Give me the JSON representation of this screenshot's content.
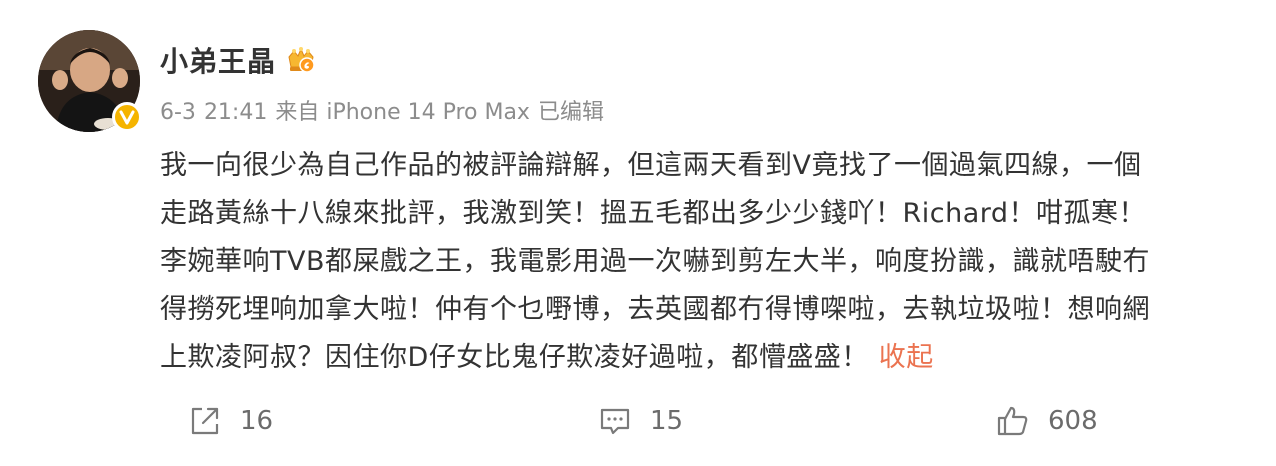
{
  "post": {
    "username": "小弟王晶",
    "meta": {
      "date": "6-3",
      "time": "21:41",
      "source": "来自 iPhone 14 Pro Max",
      "edited": "已编辑"
    },
    "content_lines": [
      "我一向很少為自己作品的被評論辯解，但這兩天看到V竟找了一個過氣四線，一個",
      "走路黃絲十八線來批評，我激到笑！搵五毛都出多少少錢吖！Richard！咁孤寒！",
      "李婉華响TVB都屎戲之王，我電影用過一次嚇到剪左大半，响度扮識，識就唔駛冇",
      "得撈死埋响加拿大啦！仲有个乜嘢博，去英國都冇得博㗎啦，去執垃圾啦！想响網",
      "上欺凌阿叔？因住你D仔女比鬼仔欺凌好過啦，都懵盛盛！"
    ],
    "collapse_label": "收起",
    "actions": {
      "repost_count": "16",
      "comment_count": "15",
      "like_count": "608"
    },
    "colors": {
      "text": "#333333",
      "meta": "#8c8c8c",
      "link": "#eb7350",
      "icon": "#7a7a7a",
      "verified": "#f5b400"
    },
    "icons": {
      "repost": "share-arrow-icon",
      "comment": "comment-bubble-icon",
      "like": "thumbs-up-icon",
      "verified": "verified-v-icon",
      "vip": "vip-crown-badge-icon"
    }
  }
}
